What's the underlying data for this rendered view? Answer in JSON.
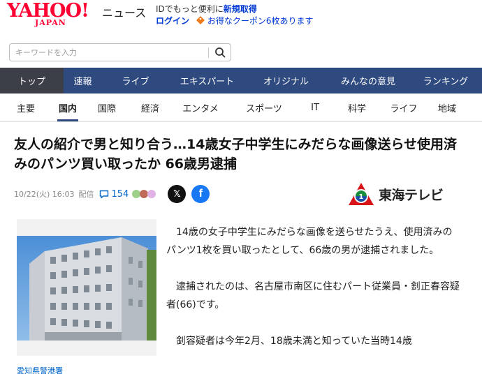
{
  "header": {
    "logo_main": "YAHOO!",
    "logo_sub": "JAPAN",
    "section_title": "ニュース",
    "promo_prefix": "IDでもっと便利に",
    "promo_link": "新規取得",
    "login": "ログイン",
    "coupon_text": "お得なクーポン6枚あります"
  },
  "search": {
    "placeholder": "キーワードを入力"
  },
  "main_nav": [
    {
      "label": "トップ",
      "active": true
    },
    {
      "label": "速報"
    },
    {
      "label": "ライブ"
    },
    {
      "label": "エキスパート"
    },
    {
      "label": "オリジナル"
    },
    {
      "label": "みんなの意見"
    },
    {
      "label": "ランキング"
    }
  ],
  "sub_nav": [
    {
      "label": "主要"
    },
    {
      "label": "国内",
      "active": true
    },
    {
      "label": "国際"
    },
    {
      "label": "経済"
    },
    {
      "label": "エンタメ"
    },
    {
      "label": "スポーツ"
    },
    {
      "label": "IT"
    },
    {
      "label": "科学"
    },
    {
      "label": "ライフ"
    },
    {
      "label": "地域"
    }
  ],
  "article": {
    "headline": "友人の紹介で男と知り合う…14歳女子中学生にみだらな画像送らせ使用済みのパンツ買い取ったか 66歳男逮捕",
    "date": "10/22(火) 16:03",
    "source_label": "配信",
    "comment_count": "154",
    "provider": "東海テレビ",
    "photo_caption": "愛知県警港署",
    "paragraphs": [
      "14歳の女子中学生にみだらな画像を送らせたうえ、使用済みのパンツ1枚を買い取ったとして、66歳の男が逮捕されました。",
      "逮捕されたのは、名古屋市南区に住むパート従業員・釗正春容疑者(66)です。",
      "釗容疑者は今年2月、18歳未満と知っていた当時14歳"
    ]
  },
  "colors": {
    "brand_red": "#ff0033",
    "nav_bg": "#2e4a7f",
    "nav_active": "#3c3f47",
    "link_blue": "#0066cc"
  }
}
